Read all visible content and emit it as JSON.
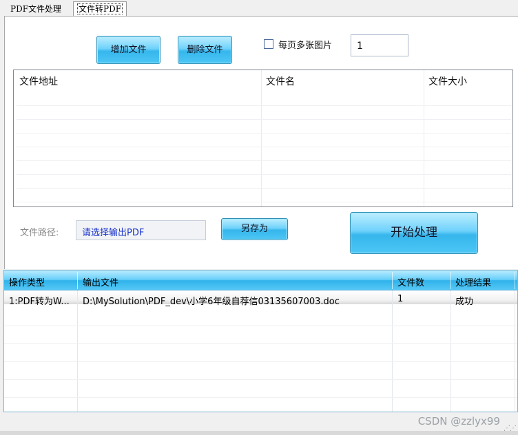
{
  "tabs": [
    {
      "label": "PDF文件处理"
    },
    {
      "label": "文件转PDF"
    }
  ],
  "toolbar": {
    "add_label": "增加文件",
    "delete_label": "删除文件",
    "multi_image_label": "每页多张图片",
    "multi_image_checked": false,
    "per_page_value": "1"
  },
  "file_list": {
    "columns": [
      "文件地址",
      "文件名",
      "文件大小"
    ],
    "rows": []
  },
  "output": {
    "path_label": "文件路径:",
    "path_value": "请选择输出PDF",
    "save_as_label": "另存为",
    "start_label": "开始处理"
  },
  "results": {
    "columns": [
      "操作类型",
      "输出文件",
      "文件数",
      "处理结果"
    ],
    "rows": [
      {
        "type": "1:PDF转为W...",
        "file": "D:\\MySolution\\PDF_dev\\小学6年级自荐信03135607003.doc",
        "count": "1",
        "result": "成功"
      }
    ]
  },
  "watermark": "CSDN @zzlyx99"
}
